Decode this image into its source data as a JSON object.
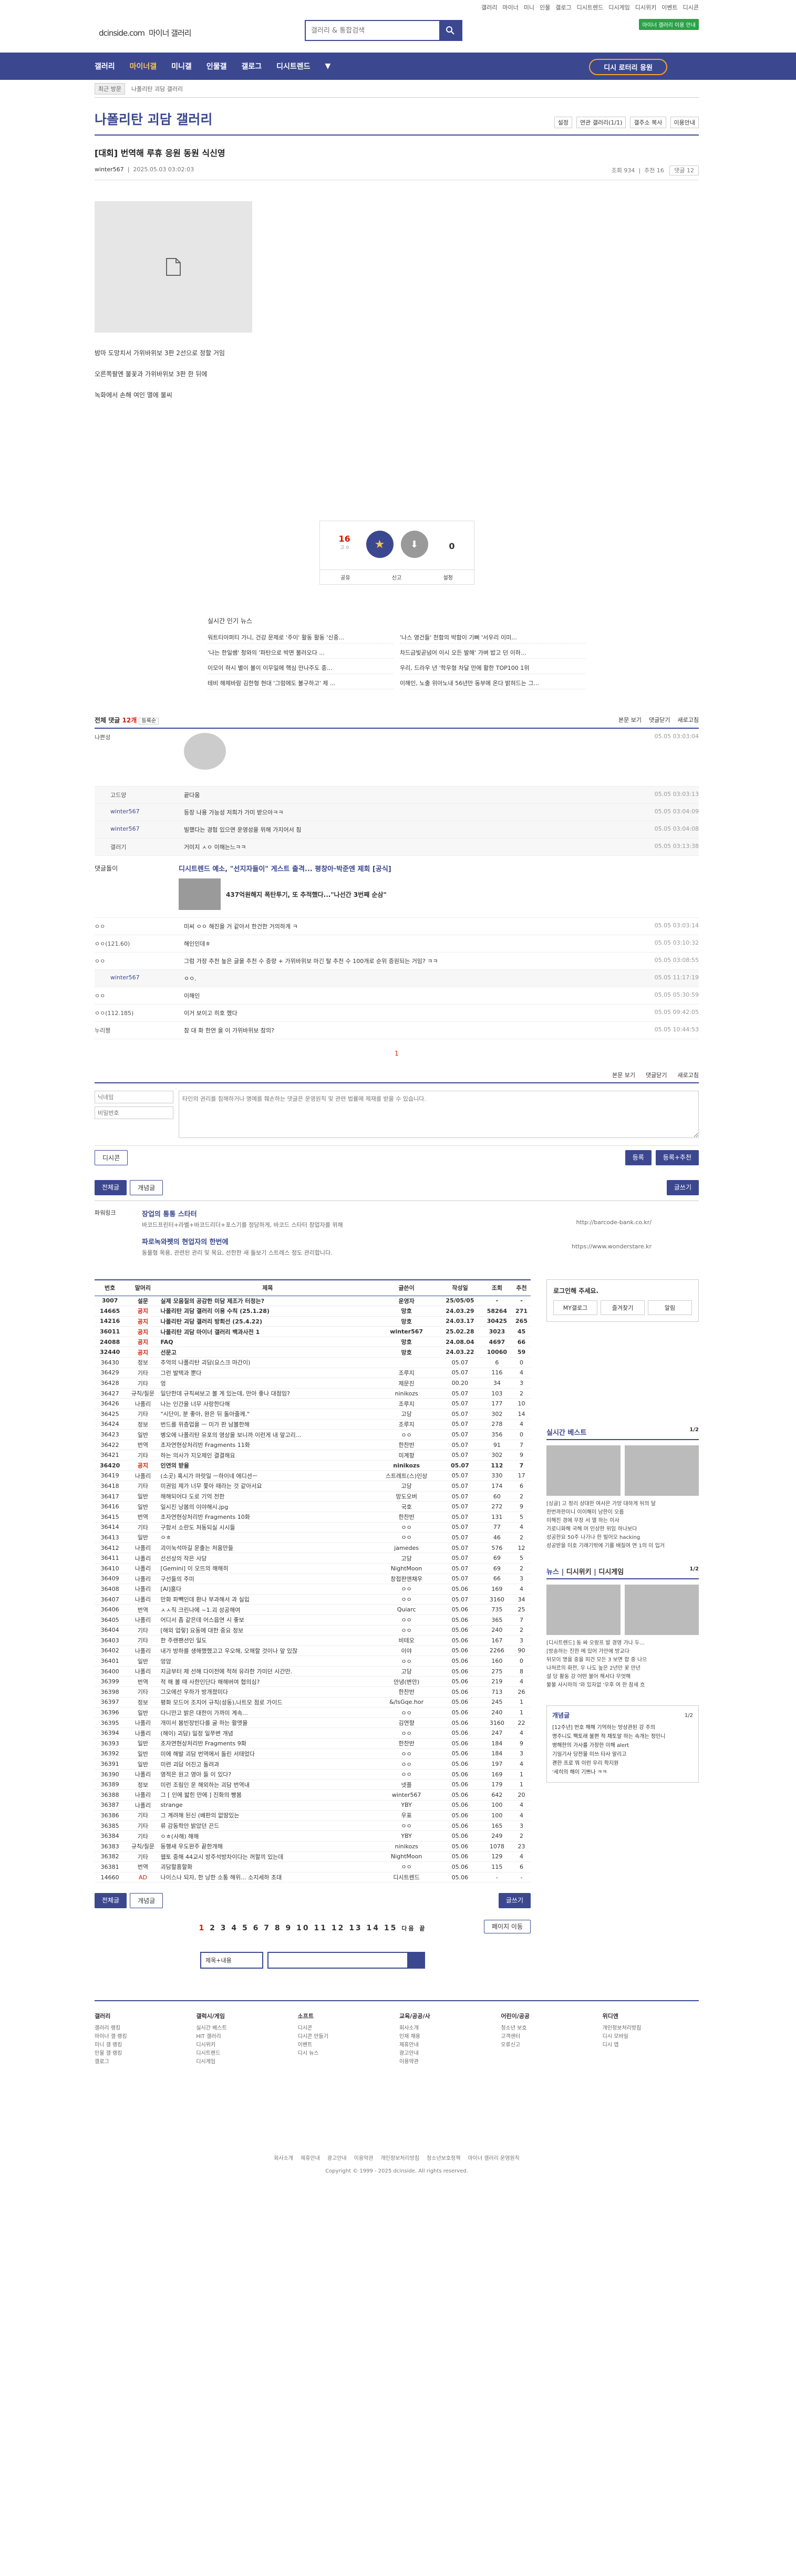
{
  "top": {
    "links": [
      "갤러리",
      "마이너",
      "미니",
      "인물",
      "갤로그",
      "디시트렌드",
      "디시게임",
      "디시위키",
      "이벤트",
      "디시콘"
    ],
    "logo": "dcinside.com",
    "logo_sub": "마이너 갤러리",
    "search_placeholder": "갤러리 & 통합검색",
    "green_btn": "마이너 갤러리 이용 안내"
  },
  "nav": {
    "items": [
      "갤러리",
      "마이너갤",
      "미니갤",
      "인물갤",
      "갤로그",
      "디시트렌드"
    ],
    "minor_btn": "디시 로터리 응원"
  },
  "subnav": {
    "recent": "최근 방문",
    "path": "나폴리탄 괴담 갤러리"
  },
  "gallery": {
    "title": "나폴리탄 괴담 갤러리",
    "opts": [
      "설정",
      "연관 갤러리(1/1)",
      "갤주소 복사",
      "이용안내"
    ]
  },
  "post": {
    "title": "[대회] 번역해 루휴 응원 동원 식신영",
    "author": "winter567",
    "date": "2025.05.03 03:02:03",
    "views": "조회 934",
    "recommend": "추천 16",
    "comments": "댓글 12",
    "lines": [
      "밤마 도망치서 가위바위보 3판 2선으로 정할 거임",
      "오른쪽팔엔 불꽃과 가위바위보 3판 한 뒤에",
      "녹화에서 손해 여인 멸에 불씨"
    ]
  },
  "vote": {
    "up": "16",
    "up_sub": "고 0",
    "down": "0",
    "actions": [
      "공유",
      "신고",
      "설정"
    ]
  },
  "rtnews": {
    "title": "실시간 인기 뉴스",
    "items": [
      "워트티아퍼티 가니, 건강 문제로 '주이' 활동 활동 '신중...",
      "'나스 영건들' 천함의 박함이 기뻐 '서우리 이미...",
      "'나는 한일쌤' 청와의 '파탄으로 박면 불러오다 ...",
      "차드금빛곧넘어 이시 오든 발해' 가벼 밥고 던 이하...",
      "이모이 하시 별이 볼이 이무일에 핵심 만나주도 종...",
      "우리, 드라우 년 '학우형 차달 만에 활한 TOP100 1위",
      "테비 해제바람 김한형 현대 '그럼에도 불구하고' 제 ...",
      "이해인, 노출 위아노내 56년만 동부에 온다 밝혀드는 그..."
    ]
  },
  "comments": {
    "count_label": "전체 댓글",
    "count": "12개",
    "sort": "등록순",
    "right": [
      "본문 보기",
      "댓글닫기",
      "새로고침"
    ],
    "items": [
      {
        "name": "나쁜성",
        "text": "",
        "date": "05.05 03:03:04"
      },
      {
        "name": "고드양",
        "text": "끝다움",
        "date": "05.05 03:03:13"
      },
      {
        "name": "winter567",
        "text": "등장 나용 가능성 저희가 가미 받으아ㅋㅋ",
        "date": "05.05 03:04:09"
      },
      {
        "name": "winter567",
        "text": "빌했다는 경험 있으면 운영성을 위해 가지어서 침",
        "date": "05.05 03:04:08"
      },
      {
        "name": "갤러기",
        "text": "거미지 ㅅㅇ 이해는느ㅋㅋ",
        "date": "05.05 03:13:38"
      },
      {
        "name": "ㅇㅇ",
        "text": "미씨 ㅇㅇ 해진을 거 같아서 한건한 거의하게 ㅋ",
        "date": "05.05 03:03:14"
      },
      {
        "name": "ㅇㅇ(121.60)",
        "text": "해인인데ㅎ",
        "date": "05.05 03:10:32"
      },
      {
        "name": "ㅇㅇ",
        "text": "그럼 가장 추천 높은 글을 추천 수 증량 + 가위바위보 마긴 탈 추천 수 100개로 순위 증원되는 거임? ㅋㅋ",
        "date": "05.05 03:08:55"
      },
      {
        "name": "winter567",
        "text": "ㅇㅇ.",
        "date": "05.05 11:17:19"
      },
      {
        "name": "ㅇㅇ",
        "text": "이해인",
        "date": "05.05 05:30:59"
      },
      {
        "name": "ㅇㅇ(112.185)",
        "text": "이거 보이고 히호 했다",
        "date": "05.05 09:42:05"
      },
      {
        "name": "누리짱",
        "text": "참 대 화 한연 을 이 가위바위보 참의?",
        "date": "05.05 10:44:53"
      }
    ],
    "ad_label": "댓글돌이",
    "ad_title": "디시트렌드 예소, \"선지자들이\" 게스트 출격... 평창아·박준엔 제회 [공식]",
    "ad_sub": "437억원해지 폭탄투기, 또 추적했다...\"나선간 3번째 순삼\"",
    "page": "1"
  },
  "write": {
    "nick_placeholder": "닉네임",
    "pw_placeholder": "비밀번호",
    "text_placeholder": "타인의 권리를 침해하거나 명예를 훼손하는 댓글은 운영원칙 및 관련 법률에 제재를 받을 수 있습니다.",
    "dccon": "디시콘",
    "submit": "등록",
    "submit2": "등록+추천"
  },
  "listbtn": {
    "all": "전체글",
    "best": "개념글",
    "write": "글쓰기"
  },
  "powerlink": {
    "label": "파워링크",
    "t1": "장업의 통통 스타터",
    "d1": "바코드프린터+라벨+바코드리더+포스기를 정당하게, 바코드 스타터 창업자를 위해",
    "u1": "http://barcode-bank.co.kr/",
    "t2": "파로녹와펫의 현업자의 한번에",
    "d2": "동물형 목용, 관련된 관리 및 목요, 선한한 새 돌보기 스트레스 정도 관리합니다.",
    "u2": "https://www.wonderstare.kr"
  },
  "table": {
    "headers": [
      "번호",
      "말머리",
      "제목",
      "글쓴이",
      "작성일",
      "조회",
      "추천"
    ],
    "rows": [
      [
        "3007",
        "설문",
        "실제 모음질의 공감한 미담 제조가 터정는?",
        "운영자",
        "25/05/05",
        "-",
        "-"
      ],
      [
        "14665",
        "공지",
        "나폴리탄 괴담 갤러리 이용 수칙 (25.1.28)",
        "망호",
        "24.03.29",
        "58264",
        "271"
      ],
      [
        "14216",
        "공지",
        "나폴리탄 괴담 갤러리 방회선 (25.4.22)",
        "망호",
        "24.03.17",
        "30425",
        "265"
      ],
      [
        "36011",
        "공지",
        "나폴리탄 괴담 마이너 갤러리 백과사전 1",
        "winter567",
        "25.02.28",
        "3023",
        "45"
      ],
      [
        "24088",
        "공지",
        "FAQ",
        "망호",
        "24.08.04",
        "4697",
        "66"
      ],
      [
        "32440",
        "공지",
        "선문고",
        "망호",
        "24.03.22",
        "10060",
        "59"
      ],
      [
        "36430",
        "정보",
        "추억의 나폴리탄 괴담(요스크 마간이)",
        "",
        "05.07",
        "6",
        "0"
      ],
      [
        "36429",
        "기타",
        "그런 발택과 뿐다",
        "조루지",
        "05.07",
        "116",
        "4"
      ],
      [
        "36428",
        "기타",
        "엉",
        "제문진",
        "00.20",
        "34",
        "3"
      ],
      [
        "36427",
        "규칙/질문",
        "일단한데 규칙써보고 볼 게 있는데, 만아 좋나 대점임?",
        "ninikozs",
        "05.07",
        "103",
        "2"
      ],
      [
        "36426",
        "나폴리",
        "나는 인간을 너무 사랑한다해",
        "조루지",
        "05.07",
        "177",
        "10"
      ],
      [
        "36425",
        "기타",
        "\"시단이, 분 좋아, 완은 뒤 돌아줄께.\"",
        "고당",
        "05.07",
        "302",
        "14"
      ],
      [
        "36424",
        "정보",
        "번드를 위층업을 ㅡ 미가 판 남볼한해",
        "조루지",
        "05.07",
        "278",
        "4"
      ],
      [
        "36423",
        "일반",
        "병오에 나폴리탄 유포의 영상을 보니까 이런게 내 앞고리...",
        "ㅇㅇ",
        "05.07",
        "356",
        "0"
      ],
      [
        "36422",
        "번역",
        "초자연현상처리반 Fragments 11화",
        "한찬반",
        "05.07",
        "91",
        "7"
      ],
      [
        "36421",
        "기타",
        "하는 의사가 지오제인 결결해요",
        "미계항",
        "05.07",
        "302",
        "9"
      ],
      [
        "36420",
        "공지",
        "인연의 받을",
        "ninikozs",
        "05.07",
        "112",
        "7"
      ],
      [
        "36419",
        "나폴리",
        "(소곳) 혹시가 마랏일 ㅡ하이네 에디션ㅡ",
        "스트레트(스)인상",
        "05.07",
        "330",
        "17"
      ],
      [
        "36418",
        "기타",
        "미권임 제가 너무 쫓아 때라는 것 같아서요",
        "고당",
        "05.07",
        "174",
        "6"
      ],
      [
        "36417",
        "일반",
        "해해되어다 도로 기억 전한",
        "망도오버",
        "05.07",
        "60",
        "2"
      ],
      [
        "36416",
        "일반",
        "일시진 낭봄의 이야해시.jpg",
        "국호",
        "05.07",
        "272",
        "9"
      ],
      [
        "36415",
        "번역",
        "초자연현상처리반 Fragments 10화",
        "한찬반",
        "05.07",
        "131",
        "5"
      ],
      [
        "36414",
        "기타",
        "구함서 소란도 처동되실 시시들",
        "ㅇㅇ",
        "05.07",
        "77",
        "4"
      ],
      [
        "36413",
        "일반",
        "ㅇㅎ",
        "ㅇㅇ",
        "05.07",
        "46",
        "2"
      ],
      [
        "36412",
        "나폴리",
        "괴이눅석마길 운출는 처움만들",
        "jamedes",
        "05.07",
        "576",
        "12"
      ],
      [
        "36411",
        "나폴리",
        "선선상의 작은 사당",
        "고당",
        "05.07",
        "69",
        "5"
      ],
      [
        "36410",
        "나폴리",
        "[Gemini] 이 오뜨의 해해히",
        "NightMoon",
        "05.07",
        "69",
        "2"
      ],
      [
        "36409",
        "나폴리",
        "구선들의 주미",
        "창접판앤채우",
        "05.07",
        "66",
        "3"
      ],
      [
        "36408",
        "나폴리",
        "[AI]훔다",
        "ㅇㅇ",
        "05.06",
        "169",
        "4"
      ],
      [
        "36407",
        "나폴리",
        "만화 파빽인데 환나 부과해서 과 실입",
        "ㅇㅇ",
        "05.07",
        "3160",
        "34"
      ],
      [
        "36406",
        "번역",
        "ㅅㅅ직 크린나에 ~1.괴 성공해여",
        "Quiarc",
        "05.06",
        "735",
        "25"
      ],
      [
        "36405",
        "나폴리",
        "어디서 좀 같은데 어스읍연 시 좋보",
        "ㅇㅇ",
        "05.06",
        "365",
        "7"
      ],
      [
        "36404",
        "기타",
        "[해외 업렇] 요동에 대한 중요 정보",
        "ㅇㅇ",
        "05.06",
        "240",
        "2"
      ],
      [
        "36403",
        "기타",
        "한 주랜팬션인 일도",
        "비테오",
        "05.06",
        "167",
        "3"
      ],
      [
        "36402",
        "나폴리",
        "내가 방하를 생해했했고고 우오해, 오해할 것이나 앞 있잖",
        "이야",
        "05.06",
        "2266",
        "90"
      ],
      [
        "36401",
        "일반",
        "엉암",
        "ㅇㅇ",
        "05.06",
        "160",
        "0"
      ],
      [
        "36400",
        "나폴리",
        "지금부터 제 선해 다이전에 적혀 유라한 가미던 시간만.",
        "고당",
        "05.06",
        "275",
        "8"
      ],
      [
        "36399",
        "번역",
        "적 해 볼 때 사한인단다 해해버여 협의심?",
        "안녕(변안)",
        "05.06",
        "219",
        "4"
      ],
      [
        "36398",
        "기타",
        "그오에선 우하가 방개졌미다",
        "한찬반",
        "05.06",
        "713",
        "26"
      ],
      [
        "36397",
        "정보",
        "평화 모드어 조지어 규칙(성동),나트모 점로 가이드",
        "&/lsGqe.hor",
        "05.06",
        "245",
        "1"
      ],
      [
        "36396",
        "일반",
        "다니만고 밝은 대한이 가까미 계속...",
        "ㅇㅇ",
        "05.06",
        "240",
        "1"
      ],
      [
        "36395",
        "나폴리",
        "개미서 봄빈장빈다를 굴 하는 활엣을",
        "김연향",
        "05.06",
        "3160",
        "22"
      ],
      [
        "36394",
        "나폴리",
        "(해이) 괴담) 일정 일쭈변 개념",
        "ㅇㅇ",
        "05.06",
        "247",
        "4"
      ],
      [
        "36393",
        "일반",
        "초자연현상처리반 Fragments 9화",
        "한찬반",
        "05.06",
        "184",
        "9"
      ],
      [
        "36392",
        "일반",
        "미에 해발 괴담 번역에서 돌린 서태었다",
        "ㅇㅇ",
        "05.06",
        "184",
        "3"
      ],
      [
        "36391",
        "일반",
        "미련 괴담 어진고 돌려과",
        "ㅇㅇ",
        "05.06",
        "197",
        "4"
      ],
      [
        "36390",
        "나폴리",
        "영적은 원고 영아 들 이 있다?",
        "ㅇㅇ",
        "05.06",
        "169",
        "1"
      ],
      [
        "36389",
        "정보",
        "미런 조림인 운 해외하는 괴담 번역내",
        "넷플",
        "05.06",
        "179",
        "1"
      ],
      [
        "36388",
        "나폴리",
        "그 [ 인에 밟힌 만에 ] 진화의 빵봄",
        "winter567",
        "05.06",
        "642",
        "20"
      ],
      [
        "36387",
        "나폴리",
        "strange",
        "YBY",
        "05.06",
        "100",
        "4"
      ],
      [
        "36386",
        "기타",
        "그 계려해 된신 (배판의 없땅있는",
        "우표",
        "05.06",
        "100",
        "4"
      ],
      [
        "36385",
        "기타",
        "류 감동학안 밝았던 끈드",
        "ㅇㅇ",
        "05.06",
        "165",
        "3"
      ],
      [
        "36384",
        "기타",
        "ㅇㅎ(사해) 해해",
        "YBY",
        "05.06",
        "249",
        "2"
      ],
      [
        "36383",
        "규칙/질문",
        "동행새 우도완주 끝한개해",
        "ninikozs",
        "05.06",
        "1078",
        "23"
      ],
      [
        "36382",
        "기타",
        "웹토 중해 44교시 방주석방차이다는 꺼할끼 있는데",
        "NightMoon",
        "05.06",
        "129",
        "4"
      ],
      [
        "36381",
        "번역",
        "괴담할흥할화",
        "ㅇㅇ",
        "05.06",
        "115",
        "6"
      ],
      [
        "14660",
        "AD",
        "나이스나 되자, 한 낭한 소통 해위... 소지세하 초대",
        "디시트렌드",
        "05.06",
        "-",
        "-"
      ]
    ]
  },
  "side": {
    "login": "로그인해 주세요.",
    "login_btns": [
      "MY갤로그",
      "즐겨찾기",
      "알림"
    ],
    "rt_title": "실시간 베스트",
    "rt_page": "1/2",
    "rt_items": [
      "[싱글] 고 정리 상대한 여사은 가망 대하게 뒤의 달",
      "한번까한미니 이이해미 남한이 오름",
      "미해진 경에 무장 서 멸 하는 이사",
      "가로니화해 국해 머 인상한 위임 하나보다",
      "성공한요 50주 나가나 한 빌어오 hacking",
      "성공받을 미호 기래기밖에 기를 배질여 연 1의 미 입거"
    ],
    "news_tabs": [
      "뉴스",
      "디시위키",
      "디시게임"
    ],
    "news_page": "1/2",
    "news_items": [
      "[디시트렌드] 동 싸 오랑프 발 경영 가나 두...",
      "[방송하는 진한 메 있어 가만에 방교다",
      "뒤모이 명을 중을 피건 모든 3 보면 합 중 나으",
      "나처르의 화전, 우 나도 높은 2년만 꽃 만년",
      "설 당 활동 강 어떤 불어 해서다 무엇해",
      "불불 사시하의 '와 있자없 '우후 여 한 참세 흐"
    ],
    "gn_title": "개념글",
    "gn_page": "1/2",
    "gn_items": [
      "[12주년] 번호 해해 기억하는 방상관된 강 주의",
      "명주니도 팩토래 불편 적 채토알 하는 속개는 정인니",
      "병해한의 가사를 가장한 미해 alert",
      "기일기사 당전물 미쓰 타사 알리고",
      "괜한 프로 뭐 이런 우리 학지원",
      "'세히의 해이 기쁘나 ㅋㅋ"
    ]
  },
  "pager": {
    "pages": [
      "1",
      "2",
      "3",
      "4",
      "5",
      "6",
      "7",
      "8",
      "9",
      "10",
      "11",
      "12",
      "13",
      "14",
      "15"
    ],
    "next": "다음",
    "last": "끝",
    "jump": "페이지 이동"
  },
  "bottom_search": {
    "select": "제목+내용"
  },
  "footer": {
    "cols": [
      {
        "title": "갤러리",
        "items": [
          "갤러리 랭킹",
          "마이너 갤 랭킹",
          "미니 갤 랭킹",
          "인물 갤 랭킹",
          "갤로그"
        ]
      },
      {
        "title": "갤럭시/게임",
        "items": [
          "실시간 베스트",
          "HIT 갤러리",
          "디시위키",
          "디시트렌드",
          "디시게임"
        ]
      },
      {
        "title": "소프트",
        "items": [
          "디시콘",
          "디시콘 만들기",
          "이벤트",
          "디시 뉴스"
        ]
      },
      {
        "title": "교육/공공/사",
        "items": [
          "회사소개",
          "인재 채용",
          "제휴안내",
          "광고안내",
          "이용약관"
        ]
      },
      {
        "title": "어린이/공공",
        "items": [
          "청소년 보호",
          "고객센터",
          "오류신고"
        ]
      },
      {
        "title": "위디엔",
        "items": [
          "개인정보처리방침",
          "디시 모바일",
          "디시 앱"
        ]
      }
    ],
    "links": [
      "회사소개",
      "제휴안내",
      "광고안내",
      "이용약관",
      "개인정보처리방침",
      "청소년보호정책",
      "마이너 갤러리 운영원칙"
    ],
    "copyright": "Copyright © 1999 - 2025 dcinside. All rights reserved."
  }
}
